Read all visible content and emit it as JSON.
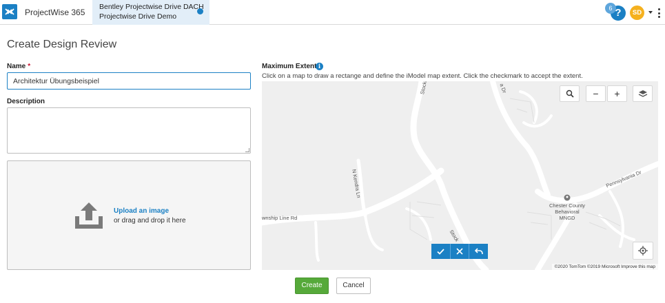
{
  "header": {
    "brand": "ProjectWise 365",
    "context_line1": "Bentley Projectwise Drive DACH",
    "context_line2": "Projectwise Drive Demo",
    "help_badge_count": "6",
    "help_label": "?",
    "avatar_initials": "SD",
    "accent_color": "#1b80c4"
  },
  "page": {
    "title": "Create Design Review"
  },
  "form": {
    "name_label": "Name",
    "name_required_mark": "*",
    "name_value": "Architektur Übungsbeispiel",
    "description_label": "Description",
    "description_value": "",
    "upload_link": "Upload an image",
    "upload_sub": "or drag and drop it here"
  },
  "extent": {
    "label": "Maximum Extent",
    "info_icon": "i",
    "help_text": "Click on a map to draw a rectange and define the iModel map extent. Click the checkmark to accept the extent."
  },
  "map": {
    "road_labels": {
      "stockton_top": "Stockton L",
      "kendra": "N Kendra Ln",
      "township": "wnship Line Rd",
      "stockton_bottom": "Stock",
      "pennsylvania": "Pennsylvania Dr",
      "dr_top": "a Dr"
    },
    "poi_label_line1": "Chester County",
    "poi_label_line2": "Behavioral MNGD",
    "attribution": "©2020 TomTom ©2019 Microsoft  Improve this map",
    "controls": {
      "search_icon": "search-icon",
      "zoom_out": "−",
      "zoom_in": "+",
      "layers_icon": "layers-icon",
      "locate_icon": "locate-icon"
    }
  },
  "actions": {
    "create_label": "Create",
    "cancel_label": "Cancel",
    "create_color": "#56a93a"
  }
}
